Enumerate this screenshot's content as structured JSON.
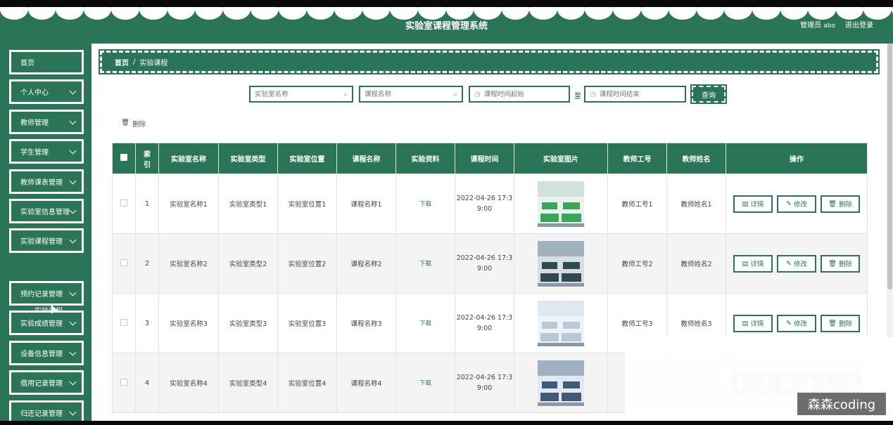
{
  "app": {
    "title": "实验室课程管理系统"
  },
  "user": {
    "role_label": "管理员",
    "username": "abo",
    "logout": "退出登录"
  },
  "sidebar": {
    "items": [
      {
        "label": "首页",
        "has_children": false
      },
      {
        "label": "个人中心",
        "has_children": true
      },
      {
        "label": "教师管理",
        "has_children": true
      },
      {
        "label": "学生管理",
        "has_children": true
      },
      {
        "label": "教师课表管理",
        "has_children": true
      },
      {
        "label": "实验室信息管理",
        "has_children": true
      },
      {
        "label": "实验课程管理",
        "has_children": true
      },
      {
        "label": "预约记录管理",
        "has_children": true
      },
      {
        "label": "实验成绩管理",
        "has_children": true
      },
      {
        "label": "设备信息管理",
        "has_children": true
      },
      {
        "label": "借用记录管理",
        "has_children": true
      },
      {
        "label": "归还记录管理",
        "has_children": true
      }
    ],
    "sub_item": "实验课程"
  },
  "breadcrumb": {
    "home": "首页",
    "separator": "/",
    "current": "实验课程"
  },
  "search": {
    "lab_name_placeholder": "实验室名称",
    "course_name_placeholder": "课程名称",
    "time_start_placeholder": "课程时间起始",
    "to_label": "至",
    "time_end_placeholder": "课程时间结束",
    "query_button": "查询"
  },
  "toolbar": {
    "delete_label": "删除"
  },
  "table": {
    "headers": [
      "",
      "索引",
      "实验室名称",
      "实验室类型",
      "实验室位置",
      "课程名称",
      "实验资料",
      "课程时间",
      "实验室图片",
      "教师工号",
      "教师姓名",
      "操作"
    ],
    "rows": [
      {
        "index": "1",
        "lab_name": "实验室名称1",
        "lab_type": "实验室类型1",
        "lab_loc": "实验室位置1",
        "course": "课程名称1",
        "material": "下载",
        "time": "2022-04-26 17:39:00",
        "teacher_no": "教师工号1",
        "teacher_name": "教师姓名1"
      },
      {
        "index": "2",
        "lab_name": "实验室名称2",
        "lab_type": "实验室类型2",
        "lab_loc": "实验室位置2",
        "course": "课程名称2",
        "material": "下载",
        "time": "2022-04-26 17:39:00",
        "teacher_no": "教师工号2",
        "teacher_name": "教师姓名2"
      },
      {
        "index": "3",
        "lab_name": "实验室名称3",
        "lab_type": "实验室类型3",
        "lab_loc": "实验室位置3",
        "course": "课程名称3",
        "material": "下载",
        "time": "2022-04-26 17:39:00",
        "teacher_no": "教师工号3",
        "teacher_name": "教师姓名3"
      },
      {
        "index": "4",
        "lab_name": "实验室名称4",
        "lab_type": "实验室类型4",
        "lab_loc": "实验室位置4",
        "course": "课程名称4",
        "material": "下载",
        "time": "2022-04-26 17:39:00",
        "teacher_no": "",
        "teacher_name": ""
      }
    ],
    "actions": {
      "detail": "详情",
      "edit": "修改",
      "delete": "删除"
    }
  },
  "watermark": "森森coding",
  "colors": {
    "primary": "#2a7557",
    "header_bg": "#2a7557"
  }
}
